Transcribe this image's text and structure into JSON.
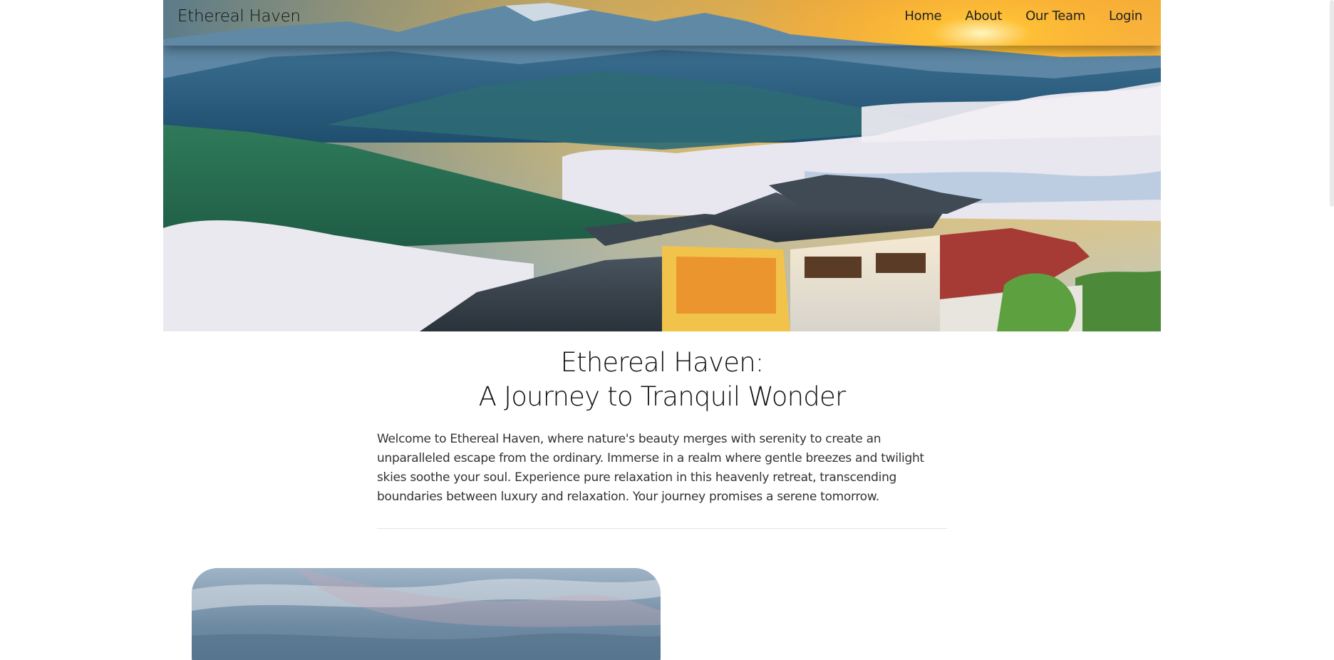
{
  "brand": "Ethereal Haven",
  "nav": [
    "Home",
    "About",
    "Our Team",
    "Login"
  ],
  "hero": {
    "image": "mountain-resort-above-clouds-photo"
  },
  "heading": {
    "line1": "Ethereal Haven:",
    "line2": "A Journey to Tranquil Wonder"
  },
  "intro": "Welcome to Ethereal Haven, where nature's beauty merges with serenity to create an unparalleled escape from the ordinary. Immerse in a realm where gentle breezes and twilight skies soothe your soul. Experience pure relaxation in this heavenly retreat, transcending boundaries between luxury and relaxation. Your journey promises a serene tomorrow.",
  "card": {
    "image": "sky-clouds-photo"
  }
}
